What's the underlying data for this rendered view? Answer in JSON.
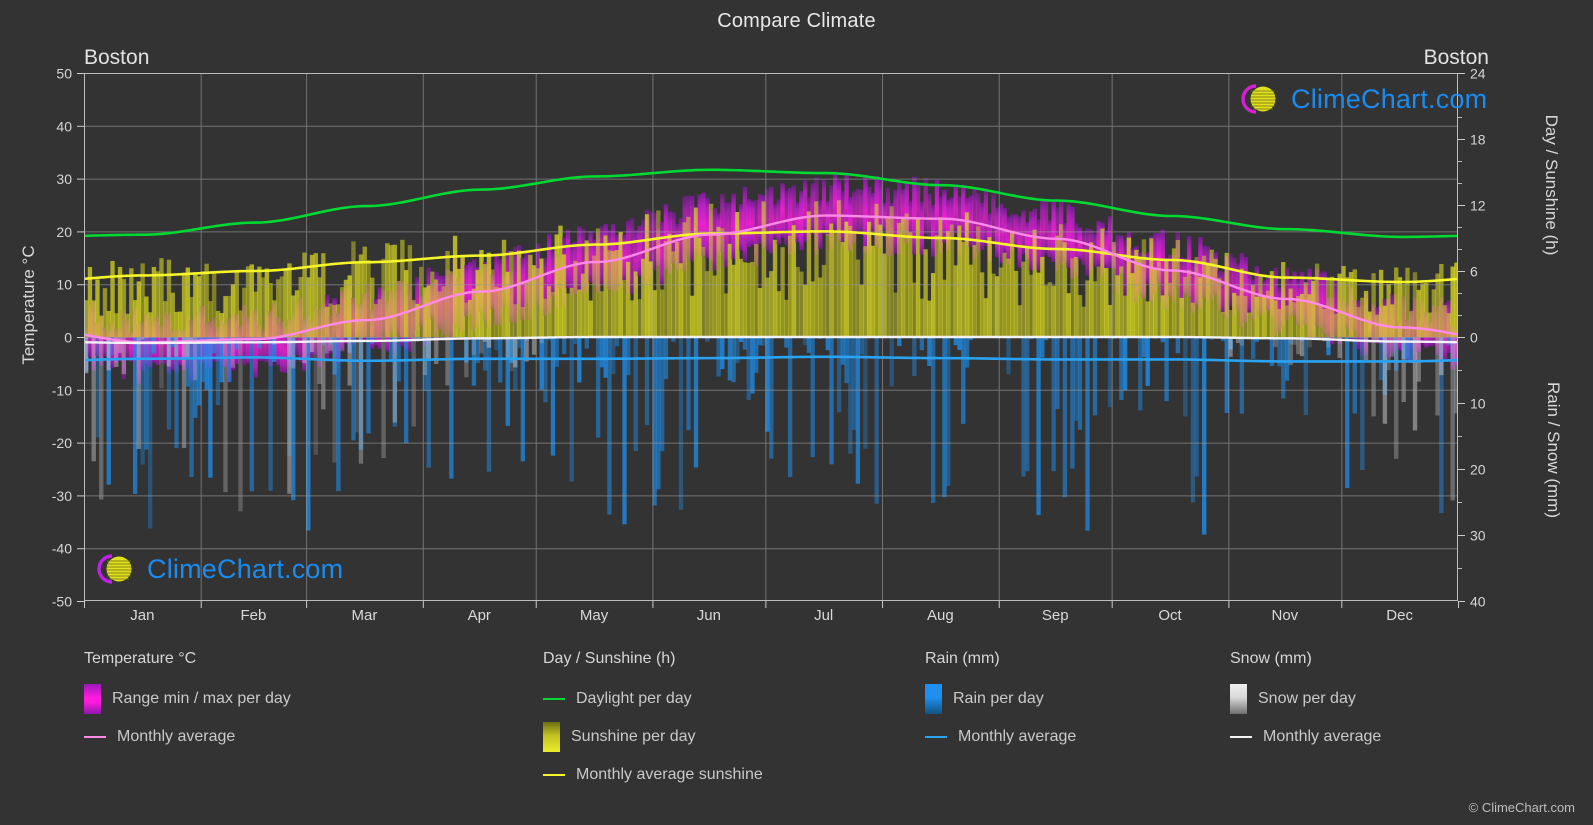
{
  "header": {
    "title": "Compare Climate",
    "city_left": "Boston",
    "city_right": "Boston"
  },
  "axes": {
    "left_title": "Temperature °C",
    "right_title_top": "Day / Sunshine (h)",
    "right_title_bottom": "Rain / Snow (mm)"
  },
  "legend": {
    "temperature": {
      "heading": "Temperature °C",
      "items": [
        {
          "label": "Range min / max per day",
          "marker": "gradient-box",
          "color": "#ff00d0"
        },
        {
          "label": "Monthly average",
          "marker": "line",
          "color": "#ff8ae8"
        }
      ]
    },
    "daysun": {
      "heading": "Day / Sunshine (h)",
      "items": [
        {
          "label": "Daylight per day",
          "marker": "line",
          "color": "#00d932"
        },
        {
          "label": "Sunshine per day",
          "marker": "gradient-box",
          "color": "#eaea20"
        },
        {
          "label": "Monthly average sunshine",
          "marker": "line",
          "color": "#f5f52a"
        }
      ]
    },
    "rain": {
      "heading": "Rain (mm)",
      "items": [
        {
          "label": "Rain per day",
          "marker": "gradient-box",
          "color": "#1c8ae8"
        },
        {
          "label": "Monthly average",
          "marker": "line",
          "color": "#2aa3f2"
        }
      ]
    },
    "snow": {
      "heading": "Snow (mm)",
      "items": [
        {
          "label": "Snow per day",
          "marker": "gradient-box",
          "color": "#dcdcdc"
        },
        {
          "label": "Monthly average",
          "marker": "line",
          "color": "#f2f2f2"
        }
      ]
    }
  },
  "watermark": {
    "text": "ClimeChart.com",
    "footer": "© ClimeChart.com"
  },
  "chart_data": {
    "type": "line",
    "title": "Compare Climate",
    "subtitle": "Boston",
    "xlabel": "",
    "ylabel": "Temperature °C",
    "grid": true,
    "legend_position": "bottom",
    "categories": [
      "Jan",
      "Feb",
      "Mar",
      "Apr",
      "May",
      "Jun",
      "Jul",
      "Aug",
      "Sep",
      "Oct",
      "Nov",
      "Dec"
    ],
    "axis_left": {
      "label": "Temperature °C",
      "ticks": [
        50,
        40,
        30,
        20,
        10,
        0,
        -10,
        -20,
        -30,
        -40,
        -50
      ],
      "range": [
        -50,
        50
      ],
      "unit": "°C"
    },
    "axis_right_top": {
      "label": "Day / Sunshine (h)",
      "ticks": [
        24,
        18,
        12,
        6,
        0
      ],
      "range": [
        0,
        24
      ],
      "unit": "h"
    },
    "axis_right_bottom": {
      "label": "Rain / Snow (mm)",
      "ticks": [
        0,
        10,
        20,
        30,
        40
      ],
      "range": [
        0,
        40
      ],
      "unit": "mm"
    },
    "series": [
      {
        "name": "Daylight per day",
        "unit": "h",
        "color": "#00d932",
        "axis": "right_top",
        "values": [
          9.3,
          10.4,
          11.9,
          13.4,
          14.6,
          15.2,
          14.9,
          13.8,
          12.4,
          11.0,
          9.8,
          9.1
        ]
      },
      {
        "name": "Monthly average sunshine",
        "unit": "h",
        "color": "#f5f52a",
        "axis": "right_top",
        "values": [
          5.6,
          6.0,
          6.8,
          7.4,
          8.4,
          9.4,
          9.6,
          9.0,
          8.0,
          7.0,
          5.4,
          5.0
        ]
      },
      {
        "name": "Temperature monthly average",
        "unit": "°C",
        "color": "#ff8ae8",
        "axis": "left",
        "values": [
          -1.0,
          -0.4,
          3.2,
          8.6,
          14.2,
          19.4,
          23.0,
          22.4,
          18.6,
          12.6,
          7.2,
          1.8
        ]
      },
      {
        "name": "Rain monthly average",
        "unit": "mm",
        "color": "#2aa3f2",
        "axis": "right_bottom",
        "values": [
          3.3,
          3.1,
          3.6,
          3.3,
          3.3,
          3.2,
          3.0,
          3.2,
          3.4,
          3.4,
          3.7,
          3.7
        ],
        "note": "plotted downward from 0 mm"
      },
      {
        "name": "Snow monthly average",
        "unit": "mm",
        "color": "#f2f2f2",
        "axis": "right_bottom",
        "values": [
          0.9,
          0.8,
          0.6,
          0.2,
          0.0,
          0.0,
          0.0,
          0.0,
          0.0,
          0.0,
          0.2,
          0.7
        ],
        "note": "plotted downward from 0 mm"
      }
    ],
    "range_band": {
      "name": "Temperature range min / max per day",
      "unit": "°C",
      "color_min": "#8f1fb0",
      "color_max": "#ff00d0",
      "min": [
        -6.5,
        -6.0,
        -2.0,
        3.0,
        8.5,
        14.0,
        18.0,
        17.5,
        13.5,
        7.5,
        2.5,
        -3.0
      ],
      "max": [
        3.0,
        3.5,
        7.5,
        13.5,
        19.5,
        25.0,
        28.5,
        27.5,
        23.5,
        17.5,
        11.5,
        5.5
      ]
    },
    "sunshine_band": {
      "name": "Sunshine per day",
      "unit": "h",
      "color": "#c8c832",
      "values": [
        5.6,
        6.0,
        6.8,
        7.4,
        8.4,
        9.4,
        9.6,
        9.0,
        8.0,
        7.0,
        5.4,
        5.0
      ]
    }
  }
}
